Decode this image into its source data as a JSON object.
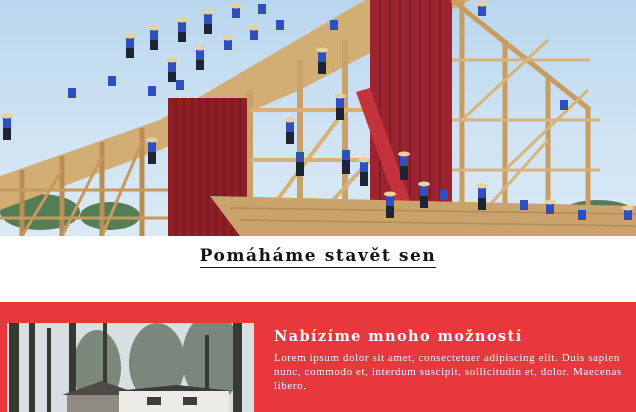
{
  "hero": {
    "image": "barn-raising-photo",
    "alt_subject": "amish-barn-construction"
  },
  "tagline": {
    "text": "Pomáháme stavět sen"
  },
  "feature": {
    "image": "house-among-trees-photo",
    "title": "Nabízíme mnoho možností",
    "body": "Lorem ipsum dolor sit amet, consectetuer adipiscing elit. Duis sapien nunc, commodo et, interdum suscipit, sollicitudin et, dolor. Maecenas libero."
  },
  "colors": {
    "accent": "#e8383c",
    "metal_roof": "#8e1f26",
    "timber": "#c9a26a",
    "worker_shirt": "#2f4fbf",
    "text_dark": "#141414",
    "text_light": "#ffffff"
  }
}
